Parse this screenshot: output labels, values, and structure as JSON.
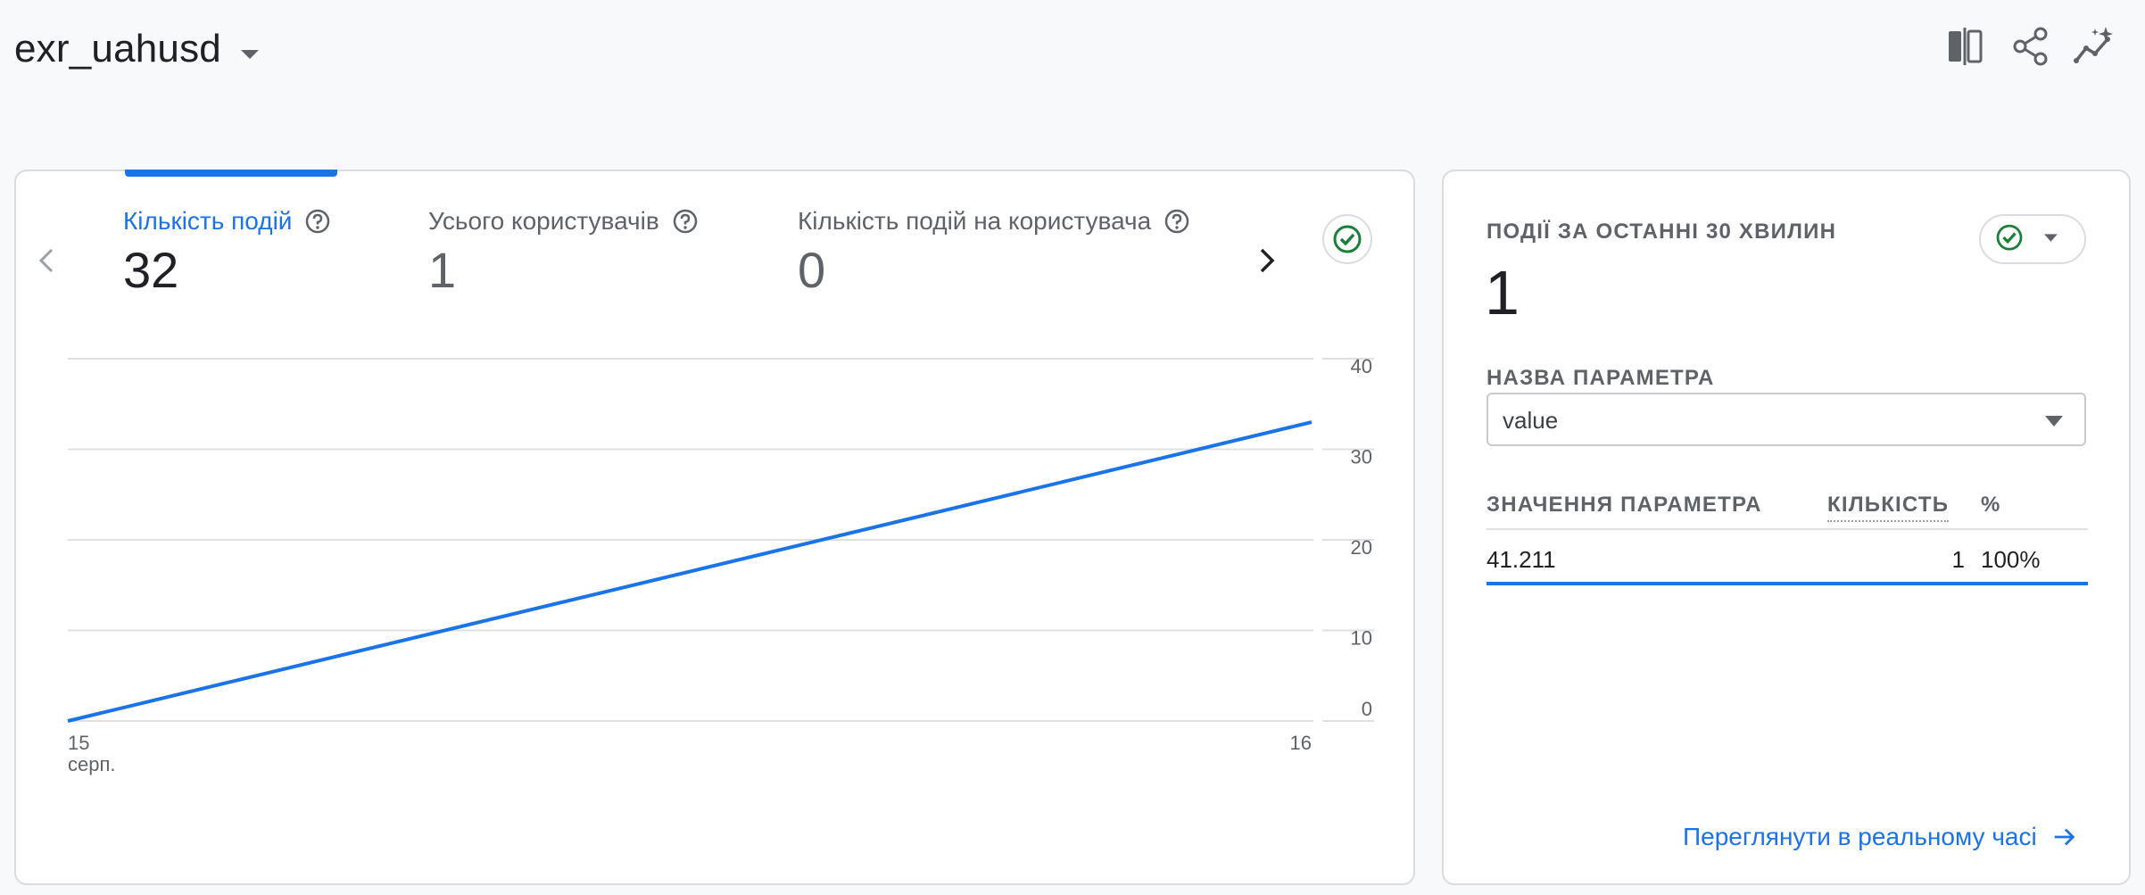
{
  "header": {
    "title": "exr_uahusd",
    "icons": [
      "compare-icon",
      "share-icon",
      "insights-icon"
    ]
  },
  "metrics": [
    {
      "label": "Кількість подій",
      "value": "32",
      "active": true
    },
    {
      "label": "Усього користувачів",
      "value": "1",
      "active": false
    },
    {
      "label": "Кількість подій на користувача",
      "value": "0",
      "active": false
    }
  ],
  "chart_data": {
    "type": "line",
    "x": [
      "15 серп.",
      "16"
    ],
    "series": [
      {
        "values": [
          0,
          33
        ]
      }
    ],
    "y_ticks": [
      "0",
      "10",
      "20",
      "30",
      "40"
    ],
    "x_tick_labels": [
      {
        "line1": "15",
        "line2": "серп."
      },
      {
        "line1": "16",
        "line2": ""
      }
    ],
    "ylim": [
      0,
      40
    ],
    "grid": true,
    "y_axis_side": "right",
    "color": "#1a73e8"
  },
  "realtime": {
    "title": "ПОДІЇ ЗА ОСТАННІ 30 ХВИЛИН",
    "count": "1",
    "param_label": "НАЗВА ПАРАМЕТРА",
    "param_value": "value",
    "columns": {
      "value": "ЗНАЧЕННЯ ПАРАМЕТРА",
      "count": "КІЛЬКІСТЬ",
      "percent": "%"
    },
    "rows": [
      {
        "value": "41.211",
        "count": "1",
        "percent": "100%"
      }
    ],
    "link": "Переглянути в реальному часі"
  },
  "colors": {
    "accent": "#1a73e8",
    "success": "#188038",
    "text": "#202124",
    "muted": "#5f6368"
  }
}
